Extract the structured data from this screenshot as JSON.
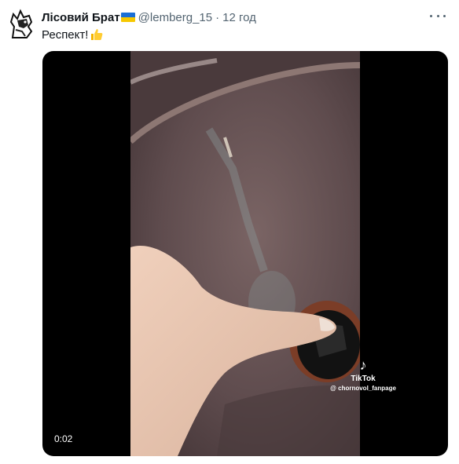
{
  "tweet": {
    "author_name": "Лісовий Брат",
    "handle": "@lemberg_15",
    "separator": "·",
    "time": "12 год",
    "text": "Респект!",
    "emoji_icon": "thumbs-up-icon",
    "flag_icon": "ukraine-flag-icon",
    "flag_colors": [
      "#1a6fd6",
      "#f6c800"
    ]
  },
  "video": {
    "duration": "0:02",
    "watermark_logo": "♪",
    "watermark_brand": "TikTok",
    "watermark_user": "@ chornovol_fanpage"
  }
}
